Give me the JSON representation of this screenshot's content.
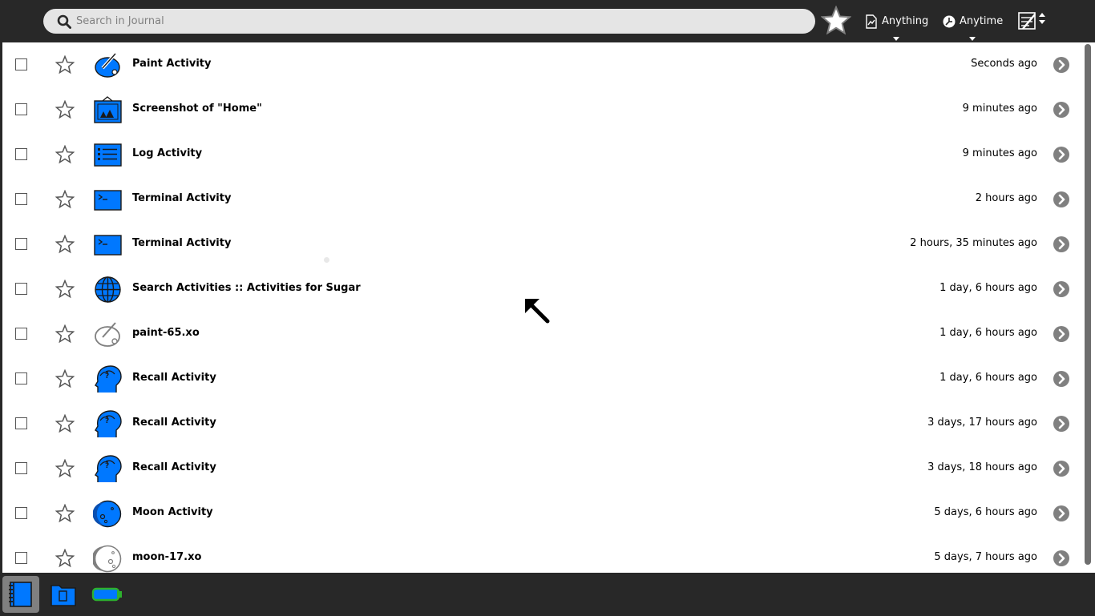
{
  "search": {
    "placeholder": "Search in Journal",
    "value": ""
  },
  "filters": {
    "what_label": "Anything",
    "when_label": "Anytime"
  },
  "colors": {
    "accent": "#0078ff",
    "toolbar": "#282828",
    "list_bg": "#ffffff"
  },
  "entries": [
    {
      "title": "Paint Activity",
      "time": "Seconds ago",
      "icon": "paint-icon"
    },
    {
      "title": "Screenshot of \"Home\"",
      "time": "9 minutes ago",
      "icon": "image-icon"
    },
    {
      "title": "Log Activity",
      "time": "9 minutes ago",
      "icon": "log-icon"
    },
    {
      "title": "Terminal Activity",
      "time": "2 hours ago",
      "icon": "terminal-icon"
    },
    {
      "title": "Terminal Activity",
      "time": "2 hours, 35 minutes ago",
      "icon": "terminal-icon"
    },
    {
      "title": "Search Activities :: Activities for Sugar",
      "time": "1 day, 6 hours ago",
      "icon": "globe-icon"
    },
    {
      "title": "paint-65.xo",
      "time": "1 day, 6 hours ago",
      "icon": "paint-bundle-icon"
    },
    {
      "title": "Recall Activity",
      "time": "1 day, 6 hours ago",
      "icon": "recall-icon"
    },
    {
      "title": "Recall Activity",
      "time": "3 days, 17 hours ago",
      "icon": "recall-icon"
    },
    {
      "title": "Recall Activity",
      "time": "3 days, 18 hours ago",
      "icon": "recall-icon"
    },
    {
      "title": "Moon Activity",
      "time": "5 days, 6 hours ago",
      "icon": "moon-icon"
    },
    {
      "title": "moon-17.xo",
      "time": "5 days, 7 hours ago",
      "icon": "moon-bundle-icon"
    }
  ],
  "tray": [
    {
      "name": "journal-icon",
      "active": true
    },
    {
      "name": "documents-folder-icon",
      "active": false
    },
    {
      "name": "usb-drive-icon",
      "active": false
    }
  ]
}
